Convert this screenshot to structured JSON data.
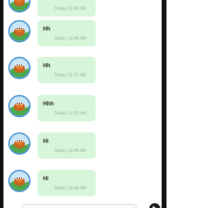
{
  "chat": {
    "messages": [
      {
        "text": "",
        "time": "Today | 11:36 AM"
      },
      {
        "text": "Hh",
        "time": "Today | 11:36 AM"
      },
      {
        "text": "Hh",
        "time": "Today | 11:37 AM"
      },
      {
        "text": "Hhh",
        "time": "Today | 11:37 AM"
      },
      {
        "text": "Hi",
        "time": "Today | 11:46 AM"
      },
      {
        "text": "Hi",
        "time": "Today | 11:46 AM"
      }
    ]
  },
  "icons": {
    "avatar": "avatar-icon",
    "send": "send-icon"
  },
  "colors": {
    "bubble": "#d7f5d9",
    "avatar_ring": "#3f8fd0",
    "frame": "#111111"
  }
}
